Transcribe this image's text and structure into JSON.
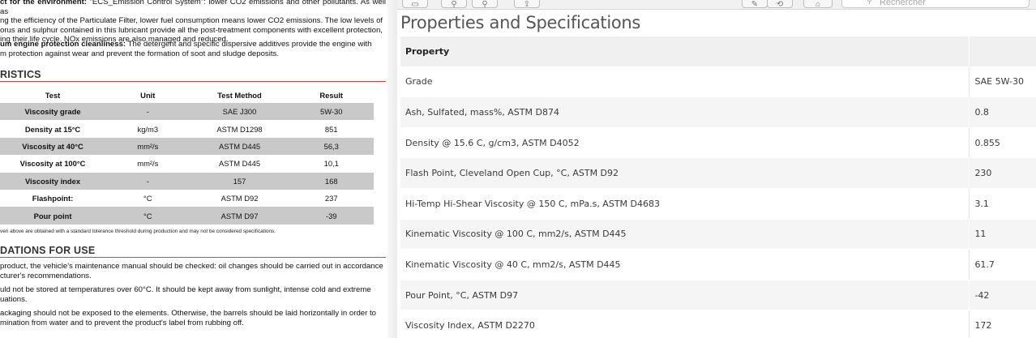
{
  "left_doc": {
    "env_para_bold": "ct for the environment:",
    "env_para_lines": [
      " \"ECS_Emission Control System\": lower CO2 emissions and other pollutants. As well as",
      "ng the efficiency of the Particulate Filter, lower fuel consumption means lower CO2 emissions. The low levels of",
      "orus and sulphur contained in this lubricant provide all the post-treatment components with excellent protection,",
      "ing their life cycle. NOx emissions are also managed and reduced."
    ],
    "clean_para_bold": "um engine protection cleanliness:",
    "clean_para_lines": [
      " The detergent and specific dispersive additives provide the engine with",
      "m protection against wear and prevent the formation of soot and sludge deposits."
    ],
    "section1_title": "RISTICS",
    "table_headers": [
      "Test",
      "Unit",
      "Test Method",
      "Result"
    ],
    "table_rows": [
      [
        "Viscosity grade",
        "-",
        "SAE J300",
        "5W-30"
      ],
      [
        "Density at 15°C",
        "kg/m3",
        "ASTM D1298",
        "851"
      ],
      [
        "Viscosity at 40°C",
        "mm²/s",
        "ASTM D445",
        "56,3"
      ],
      [
        "Viscosity at 100°C",
        "mm²/s",
        "ASTM D445",
        "10,1"
      ],
      [
        "Viscosity index",
        "-",
        "157",
        "168"
      ],
      [
        "Flashpoint:",
        "°C",
        "ASTM D92",
        "237"
      ],
      [
        "Pour point",
        "°C",
        "ASTM D97",
        "-39"
      ]
    ],
    "table_note": "ven above are obtained with a standard tolerance threshold during production and may not be considered specifications.",
    "section2_title": "DATIONS FOR USE",
    "use_para1": [
      "product, the vehicle's maintenance manual should be checked: oil changes should be carried out in accordance",
      "cturer's recommendations."
    ],
    "use_para2": [
      "uld not be stored at temperatures over 60°C. It should be kept away from sunlight, intense cold and extreme",
      "uations."
    ],
    "use_para3": [
      "ackaging should not be exposed to the elements. Otherwise, the barrels should be laid horizontally in order to",
      "mination from water and to prevent the product's label from rubbing off."
    ]
  },
  "viewer": {
    "search_placeholder": "Rechercher",
    "toolbar_icons": [
      "sidebar-icon",
      "zoom-out-icon",
      "zoom-in-icon",
      "share-icon",
      "markup-icon",
      "rotate-icon",
      "annotate-icon",
      "search-icon"
    ],
    "title": "Properties and Specifications",
    "header": [
      "Property",
      ""
    ],
    "rows": [
      [
        "Grade",
        "SAE 5W-30"
      ],
      [
        "Ash, Sulfated, mass%, ASTM D874",
        "0.8"
      ],
      [
        "Density @ 15.6 C, g/cm3, ASTM D4052",
        "0.855"
      ],
      [
        "Flash Point, Cleveland Open Cup, °C, ASTM D92",
        "230"
      ],
      [
        "Hi-Temp Hi-Shear Viscosity @ 150 C, mPa.s, ASTM D4683",
        "3.1"
      ],
      [
        "Kinematic Viscosity @ 100 C, mm2/s, ASTM D445",
        "11"
      ],
      [
        "Kinematic Viscosity @ 40 C, mm2/s, ASTM D445",
        "61.7"
      ],
      [
        "Pour Point, °C, ASTM D97",
        "-42"
      ],
      [
        "Viscosity Index, ASTM D2270",
        "172"
      ]
    ]
  }
}
